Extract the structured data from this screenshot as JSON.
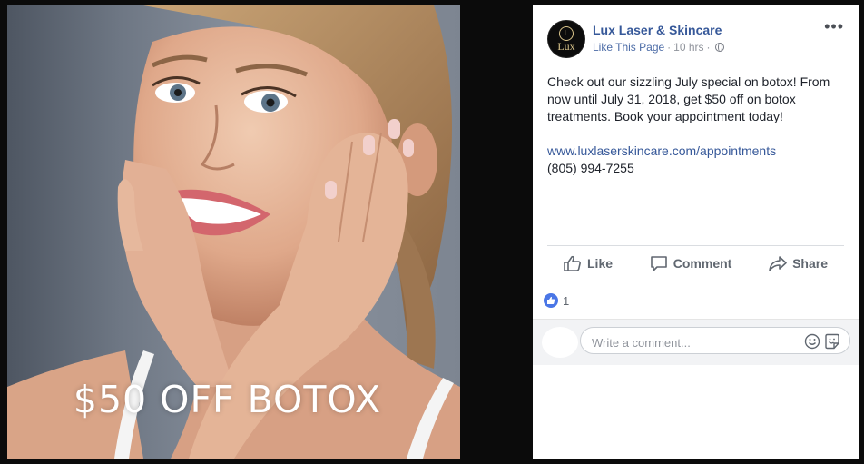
{
  "image": {
    "promo_text": "$50 OFF BOTOX"
  },
  "post": {
    "page_name": "Lux Laser & Skincare",
    "avatar_text": "Lux",
    "avatar_monogram": "L",
    "like_page": "Like This Page",
    "separator": "·",
    "time": "10 hrs",
    "separator2": "·",
    "more": "•••",
    "body": "Check out our sizzling July special on botox! From now until July 31, 2018, get $50 off on botox treatments. Book your appointment today!",
    "link": "www.luxlaserskincare.com/appointments",
    "phone": "(805) 994-7255"
  },
  "actions": {
    "like": "Like",
    "comment": "Comment",
    "share": "Share"
  },
  "reactions": {
    "count": "1"
  },
  "comment": {
    "placeholder": "Write a comment..."
  },
  "colors": {
    "link_blue": "#365899",
    "like_badge": "#4a76e6"
  }
}
